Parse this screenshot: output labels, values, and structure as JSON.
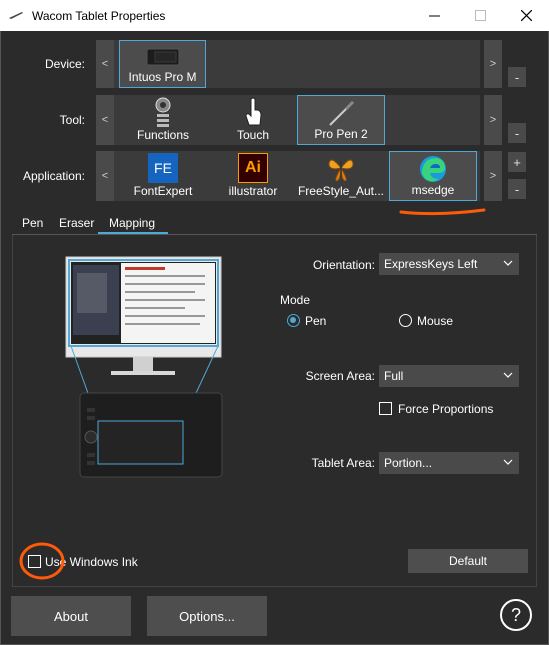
{
  "window": {
    "title": "Wacom Tablet Properties",
    "minimize_icon": "minimize-icon",
    "maximize_icon": "maximize-icon",
    "close_icon": "close-icon"
  },
  "device": {
    "label": "Device:",
    "items": [
      {
        "label": "Intuos Pro M",
        "selected": true
      }
    ]
  },
  "tool": {
    "label": "Tool:",
    "items": [
      {
        "label": "Functions",
        "selected": false
      },
      {
        "label": "Touch",
        "selected": false
      },
      {
        "label": "Pro Pen 2",
        "selected": true
      }
    ]
  },
  "application": {
    "label": "Application:",
    "items": [
      {
        "label": "FontExpert",
        "icon_text": "FE",
        "selected": false
      },
      {
        "label": "illustrator",
        "icon_text": "Ai",
        "selected": false
      },
      {
        "label": "FreeStyle_Aut...",
        "selected": false
      },
      {
        "label": "msedge",
        "selected": true
      }
    ],
    "add_label": "+",
    "remove_label": "-"
  },
  "nav": {
    "prev": "<",
    "next": ">",
    "remove": "-"
  },
  "tabs": [
    {
      "label": "Pen",
      "active": false
    },
    {
      "label": "Eraser",
      "active": false
    },
    {
      "label": "Mapping",
      "active": true
    }
  ],
  "mapping": {
    "orientation_label": "Orientation:",
    "orientation_value": "ExpressKeys Left",
    "mode_label": "Mode",
    "mode_pen_label": "Pen",
    "mode_mouse_label": "Mouse",
    "mode_selected": "Pen",
    "screen_area_label": "Screen Area:",
    "screen_area_value": "Full",
    "force_proportions_label": "Force Proportions",
    "force_proportions_checked": false,
    "tablet_area_label": "Tablet Area:",
    "tablet_area_value": "Portion...",
    "use_windows_ink_label": "Use Windows Ink",
    "use_windows_ink_checked": false,
    "default_button": "Default"
  },
  "footer": {
    "about_button": "About",
    "options_button": "Options...",
    "help_label": "?"
  },
  "colors": {
    "accent": "#4fa8d6",
    "annotation": "#ff5a0a",
    "background": "#2b2b2b"
  }
}
